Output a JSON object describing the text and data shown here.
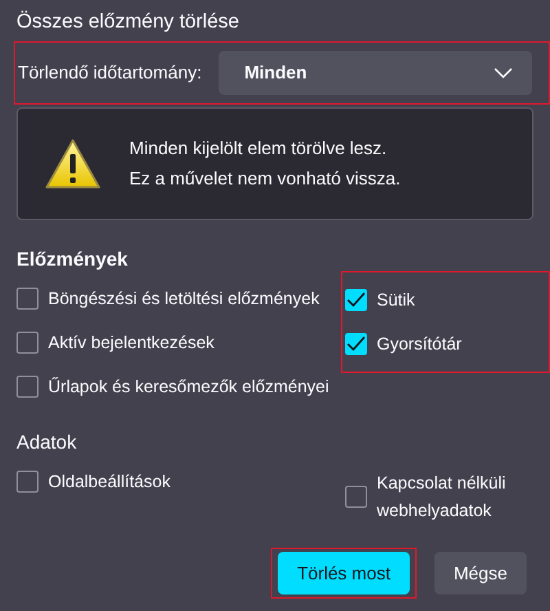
{
  "title": "Összes előzmény törlése",
  "time_range": {
    "label": "Törlendő időtartomány:",
    "value": "Minden",
    "highlighted": true
  },
  "warning": {
    "lines": [
      "Minden kijelölt elem törölve lesz.",
      "Ez a művelet nem vonható vissza."
    ]
  },
  "sections": [
    {
      "heading": "Előzmények",
      "right_highlighted": true,
      "left": [
        {
          "label": "Böngészési és letöltési előzmények",
          "checked": false
        },
        {
          "label": "Aktív bejelentkezések",
          "checked": false
        },
        {
          "label": "Űrlapok és keresőmezők előzményei",
          "checked": false
        }
      ],
      "right": [
        {
          "label": "Sütik",
          "checked": true
        },
        {
          "label": "Gyorsítótár",
          "checked": true
        }
      ]
    },
    {
      "heading": "Adatok",
      "right_highlighted": false,
      "left": [
        {
          "label": "Oldalbeállítások",
          "checked": false
        }
      ],
      "right": [
        {
          "label": "Kapcsolat nélküli webhelyadatok",
          "checked": false
        }
      ]
    }
  ],
  "buttons": [
    {
      "label": "Törlés most",
      "kind": "primary",
      "highlighted": true
    },
    {
      "label": "Mégse",
      "kind": "secondary",
      "highlighted": false
    }
  ]
}
